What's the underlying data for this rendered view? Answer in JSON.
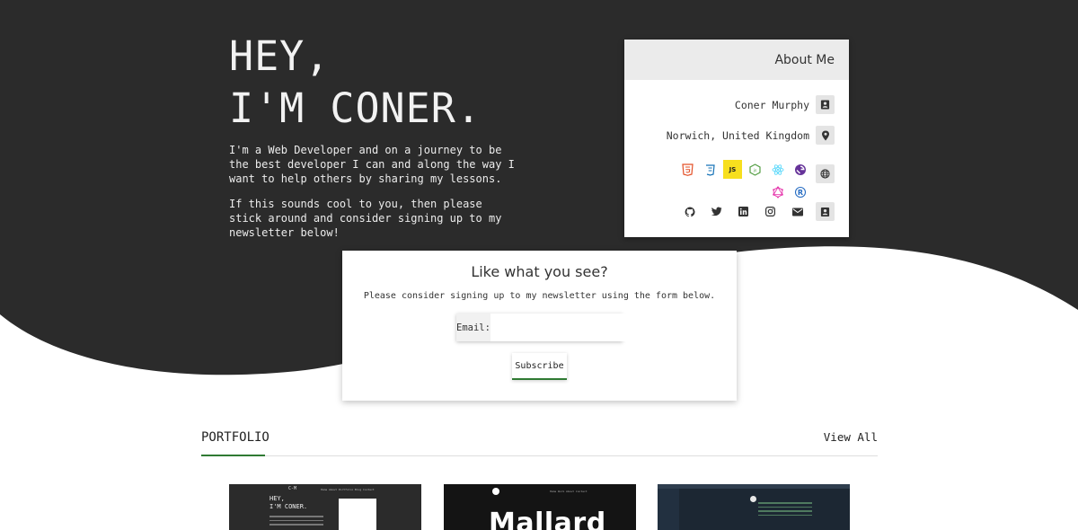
{
  "hero": {
    "title_line1": "HEY,",
    "title_line2": "I'M CONER.",
    "paragraph1": "I'm a Web Developer and on a journey to be the best developer I can and along the way I want to help others by sharing my lessons.",
    "paragraph2": "If this sounds cool to you, then please stick around and consider signing up to my newsletter below!"
  },
  "about": {
    "heading": "About Me",
    "name": "Coner Murphy",
    "location": "Norwich, United Kingdom",
    "skills": [
      "html5-icon",
      "css3-icon",
      "javascript-icon",
      "nodejs-icon",
      "react-icon",
      "gatsby-icon",
      "graphql-icon",
      "redux-icon"
    ],
    "skill_js_label": "JS",
    "socials": [
      "github-icon",
      "twitter-icon",
      "linkedin-icon",
      "instagram-icon",
      "email-icon",
      "contact-card-icon"
    ]
  },
  "newsletter": {
    "title": "Like what you see?",
    "text": "Please consider signing up to my newsletter using the form below.",
    "email_label": "Email:",
    "email_value": "",
    "subscribe_label": "Subscribe"
  },
  "portfolio": {
    "title": "PORTFOLIO",
    "view_all": "View All",
    "thumb1_logo": "C-M",
    "thumb1_nav": "Home  About  Portfolio  Blog  Contact",
    "thumb1_title_line1": "HEY,",
    "thumb1_title_line2": "I'M CONER.",
    "thumb2_nav": "Home  Work  About  Contact",
    "thumb2_word": "Mallard"
  },
  "colors": {
    "hero_dark": "#2b2b2b",
    "accent_green": "#2f7a33",
    "js_yellow": "#f7df1e"
  }
}
